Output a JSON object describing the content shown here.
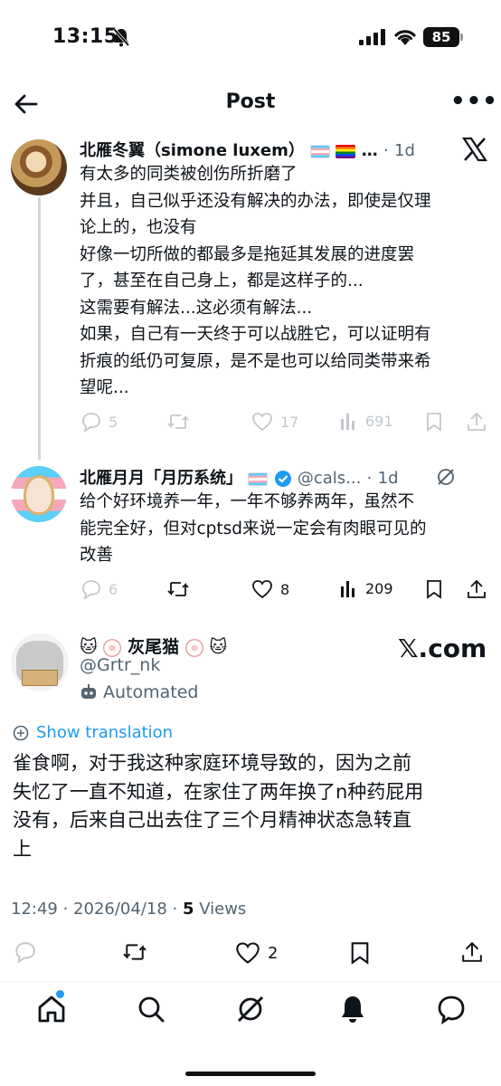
{
  "status_bar": {
    "time": "13:15",
    "battery": "85"
  },
  "header": {
    "title": "Post"
  },
  "thread": [
    {
      "display_name": "北雁冬翼（simone luxem）",
      "name_suffix": "…",
      "time_ago": "1d",
      "lines": [
        "有太多的同类被创伤所折磨了",
        "并且，自己似乎还没有解决的办法，即使是仅理",
        "论上的，也没有",
        "好像一切所做的都最多是拖延其发展的进度罢",
        "了，甚至在自己身上，都是这样子的...",
        "这需要有解法...这必须有解法...",
        "如果，自己有一天终于可以战胜它，可以证明有",
        "折痕的纸仍可复原，是不是也可以给同类带来希",
        "望呢..."
      ],
      "actions": {
        "replies": "5",
        "reposts": "",
        "likes": "17",
        "views": "691"
      }
    },
    {
      "display_name": "北雁月月「月历系统」",
      "handle": "@cals...",
      "time_ago": "1d",
      "lines": [
        "给个好环境养一年，一年不够养两年，虽然不",
        "能完全好，但对cptsd来说一定会有肉眼可见的",
        "改善"
      ],
      "actions": {
        "replies": "6",
        "reposts": "",
        "likes": "8",
        "views": "209"
      }
    }
  ],
  "main_post": {
    "name_emoji_left": "🐱",
    "display_name": "灰尾猫",
    "name_emoji_right": "🐱",
    "handle": "@Grtr_nk",
    "automated_label": "Automated",
    "xcom": "𝕏.com",
    "show_translation": "Show translation",
    "lines": [
      "雀食啊，对于我这种家庭环境导致的，因为之前",
      "失忆了一直不知道，在家住了两年换了n种药屁用",
      "没有，后来自己出去住了三个月精神状态急转直",
      "上"
    ],
    "timestamp": "12:49 · 2026/04/18 · ",
    "views_count": "5",
    "views_label": " Views",
    "actions": {
      "likes": "2"
    }
  },
  "nav": [
    "home-icon",
    "search-icon",
    "grok-icon",
    "notifications-icon",
    "messages-icon"
  ]
}
